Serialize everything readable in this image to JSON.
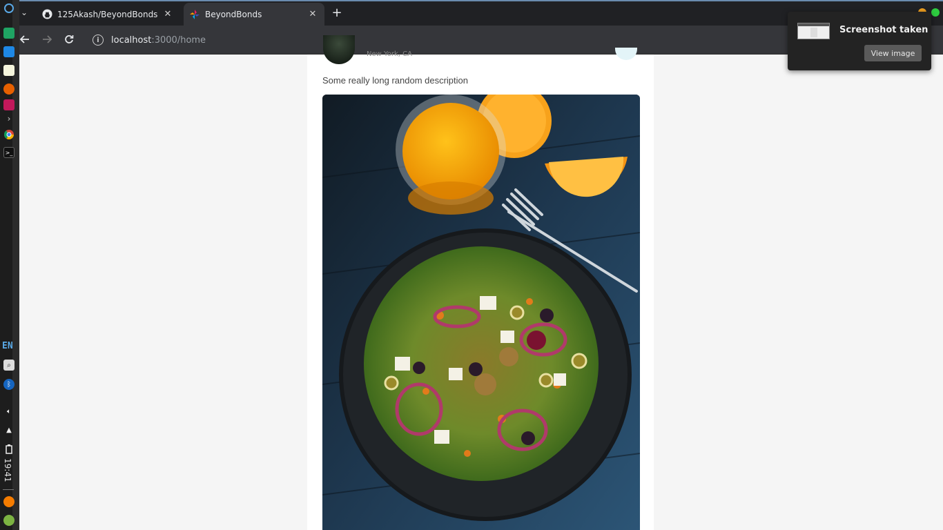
{
  "system": {
    "keyboard_layout": "EN",
    "clock": "19:41"
  },
  "browser": {
    "tabs": [
      {
        "title": "125Akash/BeyondBonds",
        "favicon": "github-icon",
        "active": false
      },
      {
        "title": "BeyondBonds",
        "favicon": "beyondbonds-logo-icon",
        "active": true
      }
    ],
    "address": {
      "host": "localhost",
      "path": ":3000/home"
    }
  },
  "post": {
    "location": "New York, CA",
    "description": "Some really long random description",
    "image_alt": "salad-bowl-with-orange-juice-photo"
  },
  "notification": {
    "title": "Screenshot taken",
    "button_label": "View image"
  },
  "colors": {
    "accent_green": "#2ecc40",
    "accent_orange": "#f0a020",
    "tab_bar": "#202124",
    "toolbar": "#35363a"
  }
}
